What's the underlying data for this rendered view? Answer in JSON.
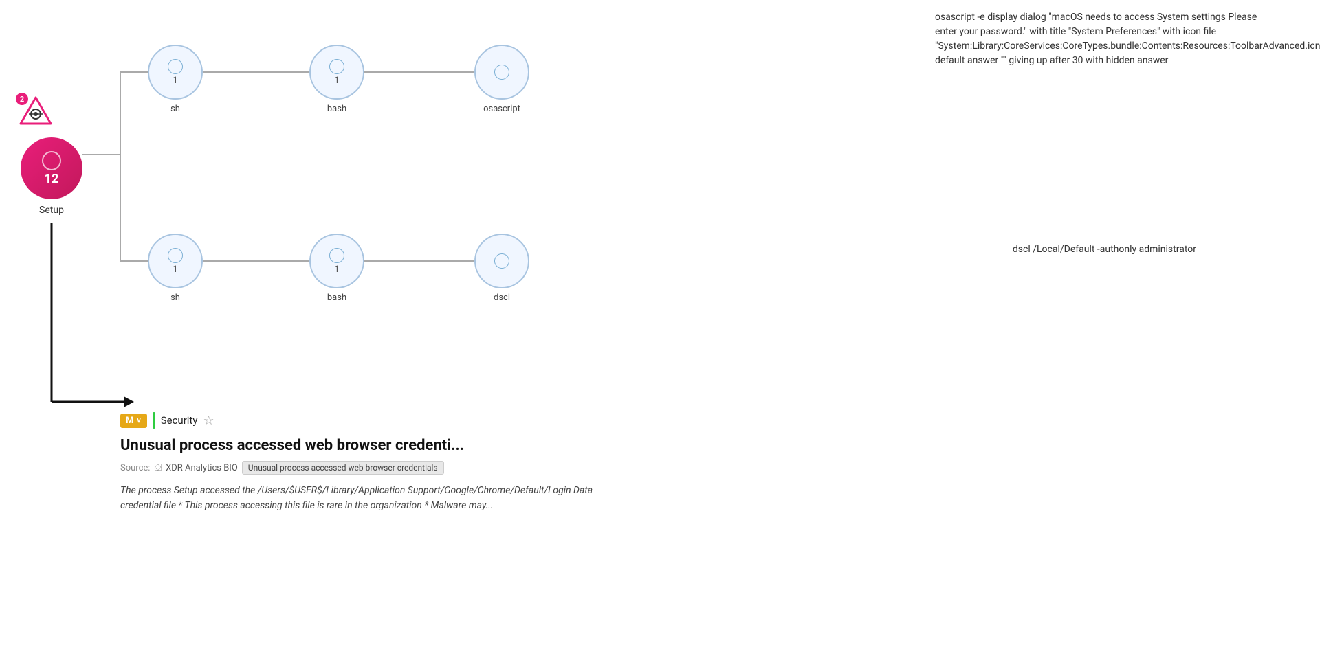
{
  "warning": {
    "badge_count": "2",
    "triangle_color": "#e91e7a"
  },
  "setup_node": {
    "count": "12",
    "label": "Setup"
  },
  "top_row": {
    "nodes": [
      {
        "inner_ring": true,
        "count": "1",
        "label": "sh"
      },
      {
        "inner_ring": true,
        "count": "1",
        "label": "bash"
      },
      {
        "inner_ring": false,
        "count": "",
        "label": "osascript"
      }
    ]
  },
  "bottom_row": {
    "nodes": [
      {
        "inner_ring": true,
        "count": "1",
        "label": "sh"
      },
      {
        "inner_ring": true,
        "count": "1",
        "label": "bash"
      },
      {
        "inner_ring": false,
        "count": "",
        "label": "dscl"
      }
    ]
  },
  "command_top": "osascript -e display dialog \"macOS needs to access System settings Please enter your password.\" with title \"System Preferences\" with icon file \"System:Library:CoreServices:CoreTypes.bundle:Contents:Resources:ToolbarAdvanced.icns\" default answer \"\" giving up after 30 with hidden answer",
  "command_bottom": "dscl /Local/Default -authonly administrator",
  "alert": {
    "m_badge": "M",
    "chevron": "∨",
    "security_label": "Security",
    "star": "☆",
    "title": "Unusual process accessed web browser credenti...",
    "source_label": "Source:",
    "xdr_label": "XDR Analytics BIO",
    "tooltip": "Unusual process accessed web browser credentials",
    "description": "The process Setup accessed the /Users/$USER$/Library/Application Support/Google/Chrome/Default/Login Data credential file * This process accessing this file is rare in the organization * Malware may..."
  }
}
